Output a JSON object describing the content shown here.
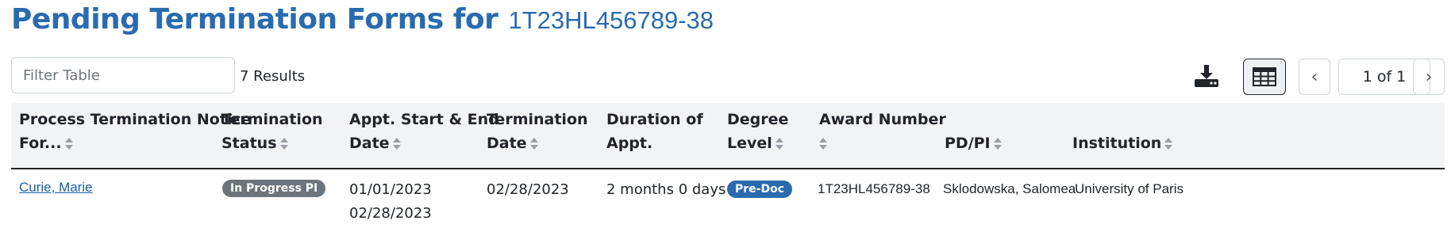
{
  "header": {
    "title": "Pending Termination Forms for",
    "award_number": "1T23HL456789-38"
  },
  "toolbar": {
    "filter_placeholder": "Filter Table",
    "results": "7 Results",
    "download_icon": "download-icon",
    "grid_icon": "table-grid-icon",
    "pagination": {
      "prev": "‹",
      "label": "1 of 1",
      "next": "›"
    }
  },
  "colors": {
    "title": "#2a6bb0",
    "status_badge": "#6c757d",
    "degree_badge": "#2a6bb0",
    "link": "#1a5fa8"
  },
  "table": {
    "columns": [
      {
        "line1": "Process Termination Notice",
        "line2": "For..."
      },
      {
        "line1": "Termination",
        "line2": "Status"
      },
      {
        "line1": "Appt. Start & End",
        "line2": "Date"
      },
      {
        "line1": "Termination",
        "line2": "Date"
      },
      {
        "line1": "Duration of",
        "line2": "Appt."
      },
      {
        "line1": "Degree",
        "line2": "Level"
      },
      {
        "line1": "Award Number",
        "line2": ""
      },
      {
        "line1": "",
        "line2": "PD/PI"
      },
      {
        "line1": "",
        "line2": "Institution"
      }
    ],
    "rows": [
      {
        "name": "Curie, Marie",
        "status": "In Progress PI",
        "start": "01/01/2023",
        "end": "02/28/2023",
        "termination_date": "02/28/2023",
        "duration": "2 months 0 days",
        "degree": "Pre-Doc",
        "award": "1T23HL456789-38",
        "pdpi": "Sklodowska, Salomea",
        "institution": "University of Paris"
      }
    ]
  }
}
